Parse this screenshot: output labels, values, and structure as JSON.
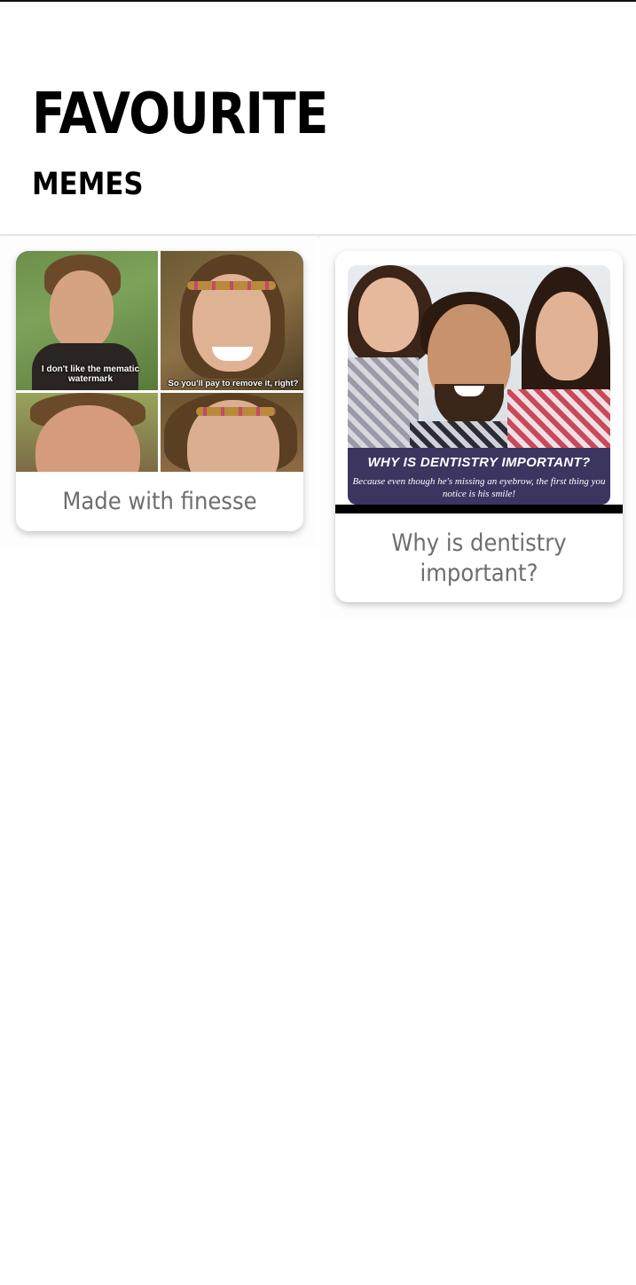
{
  "header": {
    "title": "FAVOURITE",
    "subtitle": "MEMES"
  },
  "memes": [
    {
      "caption": "Made with finesse",
      "image_text": {
        "left_panel": "I don't like the mematic watermark",
        "right_panel": "So you'll pay to remove it, right?"
      }
    },
    {
      "caption": "Why is dentistry important?",
      "image_text": {
        "headline": "WHY IS DENTISTRY IMPORTANT?",
        "subline": "Because even though he's missing an eyebrow, the first thing you notice is his smile!"
      }
    }
  ],
  "colors": {
    "title": "#000000",
    "caption": "#6e6e6e",
    "card_background": "#ffffff"
  }
}
